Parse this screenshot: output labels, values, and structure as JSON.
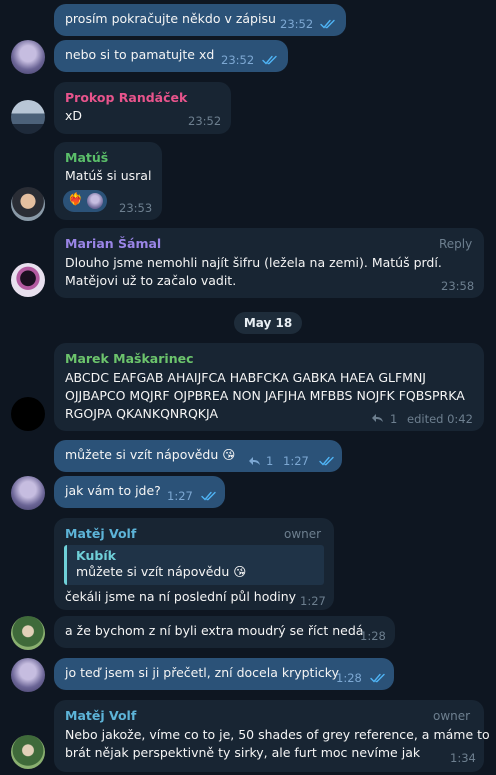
{
  "messages": {
    "m1": {
      "text": "prosím pokračujte někdo v zápisu",
      "time": "23:52"
    },
    "m2": {
      "text": "nebo si to pamatujte xd",
      "time": "23:52"
    },
    "m3": {
      "sender": "Prokop Randáček",
      "text": "xD",
      "time": "23:52"
    },
    "m4": {
      "sender": "Matúš",
      "text": "Matúš si usral",
      "time": "23:53",
      "reaction": "❤️‍🔥"
    },
    "m5": {
      "sender": "Marian Šámal",
      "action": "Reply",
      "line1": "Dlouho jsme nemohli najít šifru (ležela na zemi). Matúš prdí.",
      "line2": "Matějovi už to začalo vadit.",
      "time": "23:58"
    },
    "date": "May 18",
    "m6": {
      "sender": "Marek Maškarinec",
      "line1": "ABCDC EAFGAB AHAIJFCA HABFCKA GABKA HAEA GLFMNJ",
      "line2": "OJJBAPCO MQJRF OJPBREA NON JAFJHA MFBBS NOJFK FQBSPRKA",
      "line3": "RGOJPA QKANKQNRQKJA",
      "replies": "1",
      "time": "edited 0:42"
    },
    "m7": {
      "text": "můžete si vzít nápovědu 😘",
      "replies": "1",
      "time": "1:27"
    },
    "m8": {
      "text": "jak vám to jde?",
      "time": "1:27"
    },
    "m9": {
      "sender": "Matěj Volf",
      "role": "owner",
      "quote_sender": "Kubík",
      "quote_text": "můžete si vzít nápovědu 😘",
      "text": "čekáli jsme na ní poslední půl hodiny",
      "time": "1:27"
    },
    "m10": {
      "text": "a že bychom z ní byli extra moudrý se říct nedá",
      "time": "1:28"
    },
    "m11": {
      "text": "jo teď jsem si ji přečetl, zní docela krypticky",
      "time": "1:28"
    },
    "m12": {
      "sender": "Matěj Volf",
      "role": "owner",
      "line1": "Nebo jakože, víme co to je, 50 shades of grey reference, a máme to",
      "line2": "brát nějak perspektivně ty sirky, ale furt moc nevíme jak",
      "time": "1:34"
    }
  },
  "colors": {
    "bg": "#0e1621",
    "incoming": "#182533",
    "outgoing": "#2b5278",
    "prokop": "#e8548c",
    "matus": "#5bbf6a",
    "marian": "#9a85e6",
    "marek": "#6cc46c",
    "matej": "#5db4d8",
    "kubik": "#6fd0d8",
    "ticks": "#4fb4f5"
  }
}
